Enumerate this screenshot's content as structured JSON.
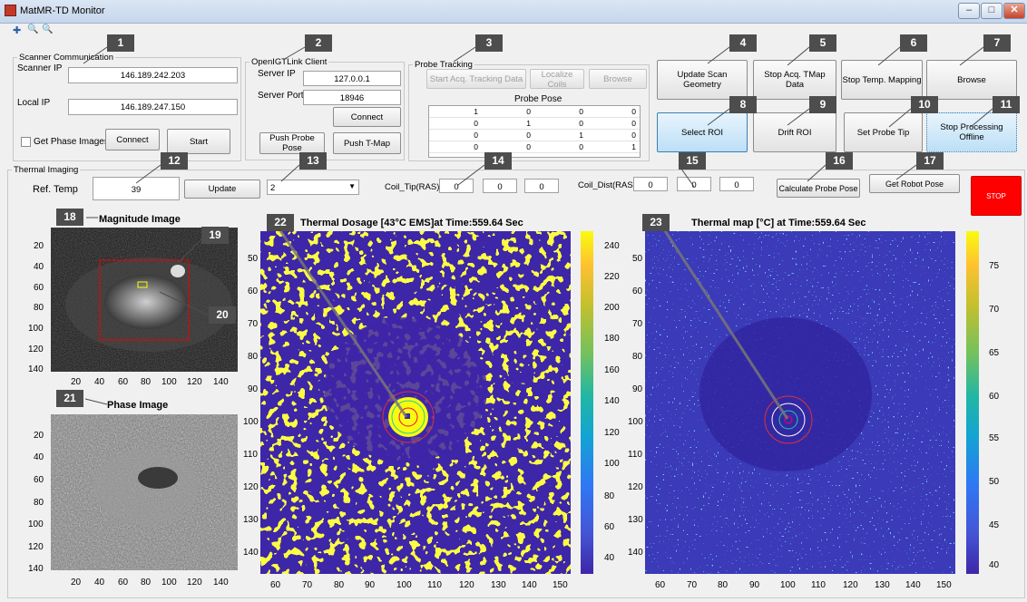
{
  "window": {
    "title": "MatMR-TD Monitor",
    "min": "–",
    "max": "□",
    "close": "✕"
  },
  "toolbar": {
    "tool1": "✚",
    "tool2": "🔍",
    "tool3": "🔍"
  },
  "scanner": {
    "legend": "Scanner Communication",
    "scanner_ip_label": "Scanner IP",
    "scanner_ip": "146.189.242.203",
    "local_ip_label": "Local IP",
    "local_ip": "146.189.247.150",
    "phase_label": "Get Phase Images",
    "connect": "Connect",
    "start": "Start"
  },
  "openigt": {
    "legend": "OpenIGTLink Client",
    "server_ip_label": "Server IP",
    "server_ip": "127.0.0.1",
    "server_port_label": "Server Port",
    "server_port": "18946",
    "connect": "Connect",
    "push_probe": "Push Probe Pose",
    "push_tmap": "Push T-Map"
  },
  "probe": {
    "legend": "Probe Tracking",
    "start_acq": "Start Acq. Tracking Data",
    "localize": "Localize Coils",
    "browse": "Browse",
    "pose_title": "Probe Pose",
    "pose": [
      [
        "1",
        "0",
        "0",
        "0"
      ],
      [
        "0",
        "1",
        "0",
        "0"
      ],
      [
        "0",
        "0",
        "1",
        "0"
      ],
      [
        "0",
        "0",
        "0",
        "1"
      ]
    ]
  },
  "buttons": {
    "update_scan": "Update Scan Geometry",
    "stop_tmap": "Stop Acq. TMap Data",
    "stop_temp": "Stop Temp. Mapping",
    "browse": "Browse",
    "select_roi": "Select ROI",
    "drift_roi": "Drift ROI",
    "set_tip": "Set Probe Tip",
    "stop_offline": "Stop Processing Offline"
  },
  "thermal": {
    "legend": "Thermal Imaging",
    "ref_label": "Ref. Temp",
    "ref_value": "39",
    "update": "Update",
    "select_value": "2",
    "coil_tip_label": "Coil_Tip(RAS)",
    "coil_tip": [
      "0",
      "0",
      "0"
    ],
    "coil_dist_label": "Coil_Dist(RAS)",
    "coil_dist": [
      "0",
      "0",
      "0"
    ],
    "calc_pose": "Calculate Probe Pose",
    "get_robot": "Get Robot Pose",
    "stop": "STOP"
  },
  "badges": [
    "1",
    "2",
    "3",
    "4",
    "5",
    "6",
    "7",
    "8",
    "9",
    "10",
    "11",
    "12",
    "13",
    "14",
    "15",
    "16",
    "17",
    "18",
    "19",
    "20",
    "21",
    "22",
    "23"
  ],
  "plots": {
    "magnitude": {
      "title": "Magnitude Image",
      "y": [
        "20",
        "40",
        "60",
        "80",
        "100",
        "120",
        "140"
      ],
      "x": [
        "20",
        "40",
        "60",
        "80",
        "100",
        "120",
        "140"
      ]
    },
    "phase": {
      "title": "Phase Image",
      "y": [
        "20",
        "40",
        "60",
        "80",
        "100",
        "120",
        "140"
      ],
      "x": [
        "20",
        "40",
        "60",
        "80",
        "100",
        "120",
        "140"
      ]
    },
    "dosage": {
      "title": "Thermal Dosage [43°C EMS]at Time:559.64 Sec",
      "y": [
        "50",
        "60",
        "70",
        "80",
        "90",
        "100",
        "110",
        "120",
        "130",
        "140"
      ],
      "x": [
        "60",
        "70",
        "80",
        "90",
        "100",
        "110",
        "120",
        "130",
        "140",
        "150"
      ],
      "cbar": [
        "240",
        "220",
        "200",
        "180",
        "160",
        "140",
        "120",
        "100",
        "80",
        "60",
        "40"
      ]
    },
    "tmap": {
      "title": "Thermal map [°C] at Time:559.64 Sec",
      "y": [
        "50",
        "60",
        "70",
        "80",
        "90",
        "100",
        "110",
        "120",
        "130",
        "140"
      ],
      "x": [
        "60",
        "70",
        "80",
        "90",
        "100",
        "110",
        "120",
        "130",
        "140",
        "150"
      ],
      "cbar": [
        "75",
        "70",
        "65",
        "60",
        "55",
        "50",
        "45",
        "40"
      ]
    }
  },
  "colors": {
    "accent_blue": "#3c7fb1",
    "stop_red": "#ff0000",
    "parula_low": "#3e26a8",
    "parula_high": "#f9fb0e"
  }
}
